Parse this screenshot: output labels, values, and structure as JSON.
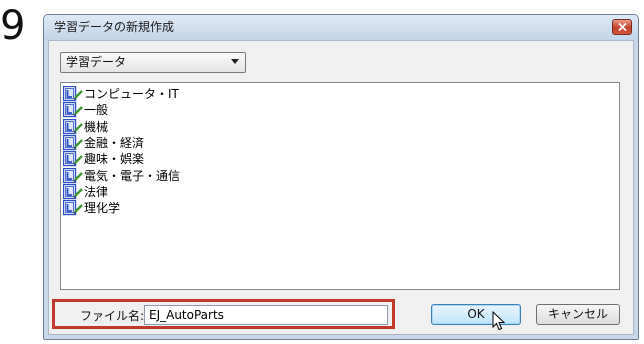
{
  "step_number": "9",
  "window": {
    "title": "学習データの新規作成",
    "close_icon": "close-icon"
  },
  "dropdown": {
    "selected": "学習データ"
  },
  "list": {
    "item_icon": "dictionary-edit-icon",
    "items": [
      {
        "label": "コンピュータ・IT"
      },
      {
        "label": "一般"
      },
      {
        "label": "機械"
      },
      {
        "label": "金融・経済"
      },
      {
        "label": "趣味・娯楽"
      },
      {
        "label": "電気・電子・通信"
      },
      {
        "label": "法律"
      },
      {
        "label": "理化学"
      }
    ]
  },
  "filename": {
    "label": "ファイル名:",
    "value": "EJ_AutoParts"
  },
  "buttons": {
    "ok": "OK",
    "cancel": "キャンセル"
  },
  "colors": {
    "highlight": "#c0392b",
    "titlebar": "#c8d8ea",
    "icon_blue": "#2b4fc4",
    "icon_green": "#3c9a2f"
  }
}
